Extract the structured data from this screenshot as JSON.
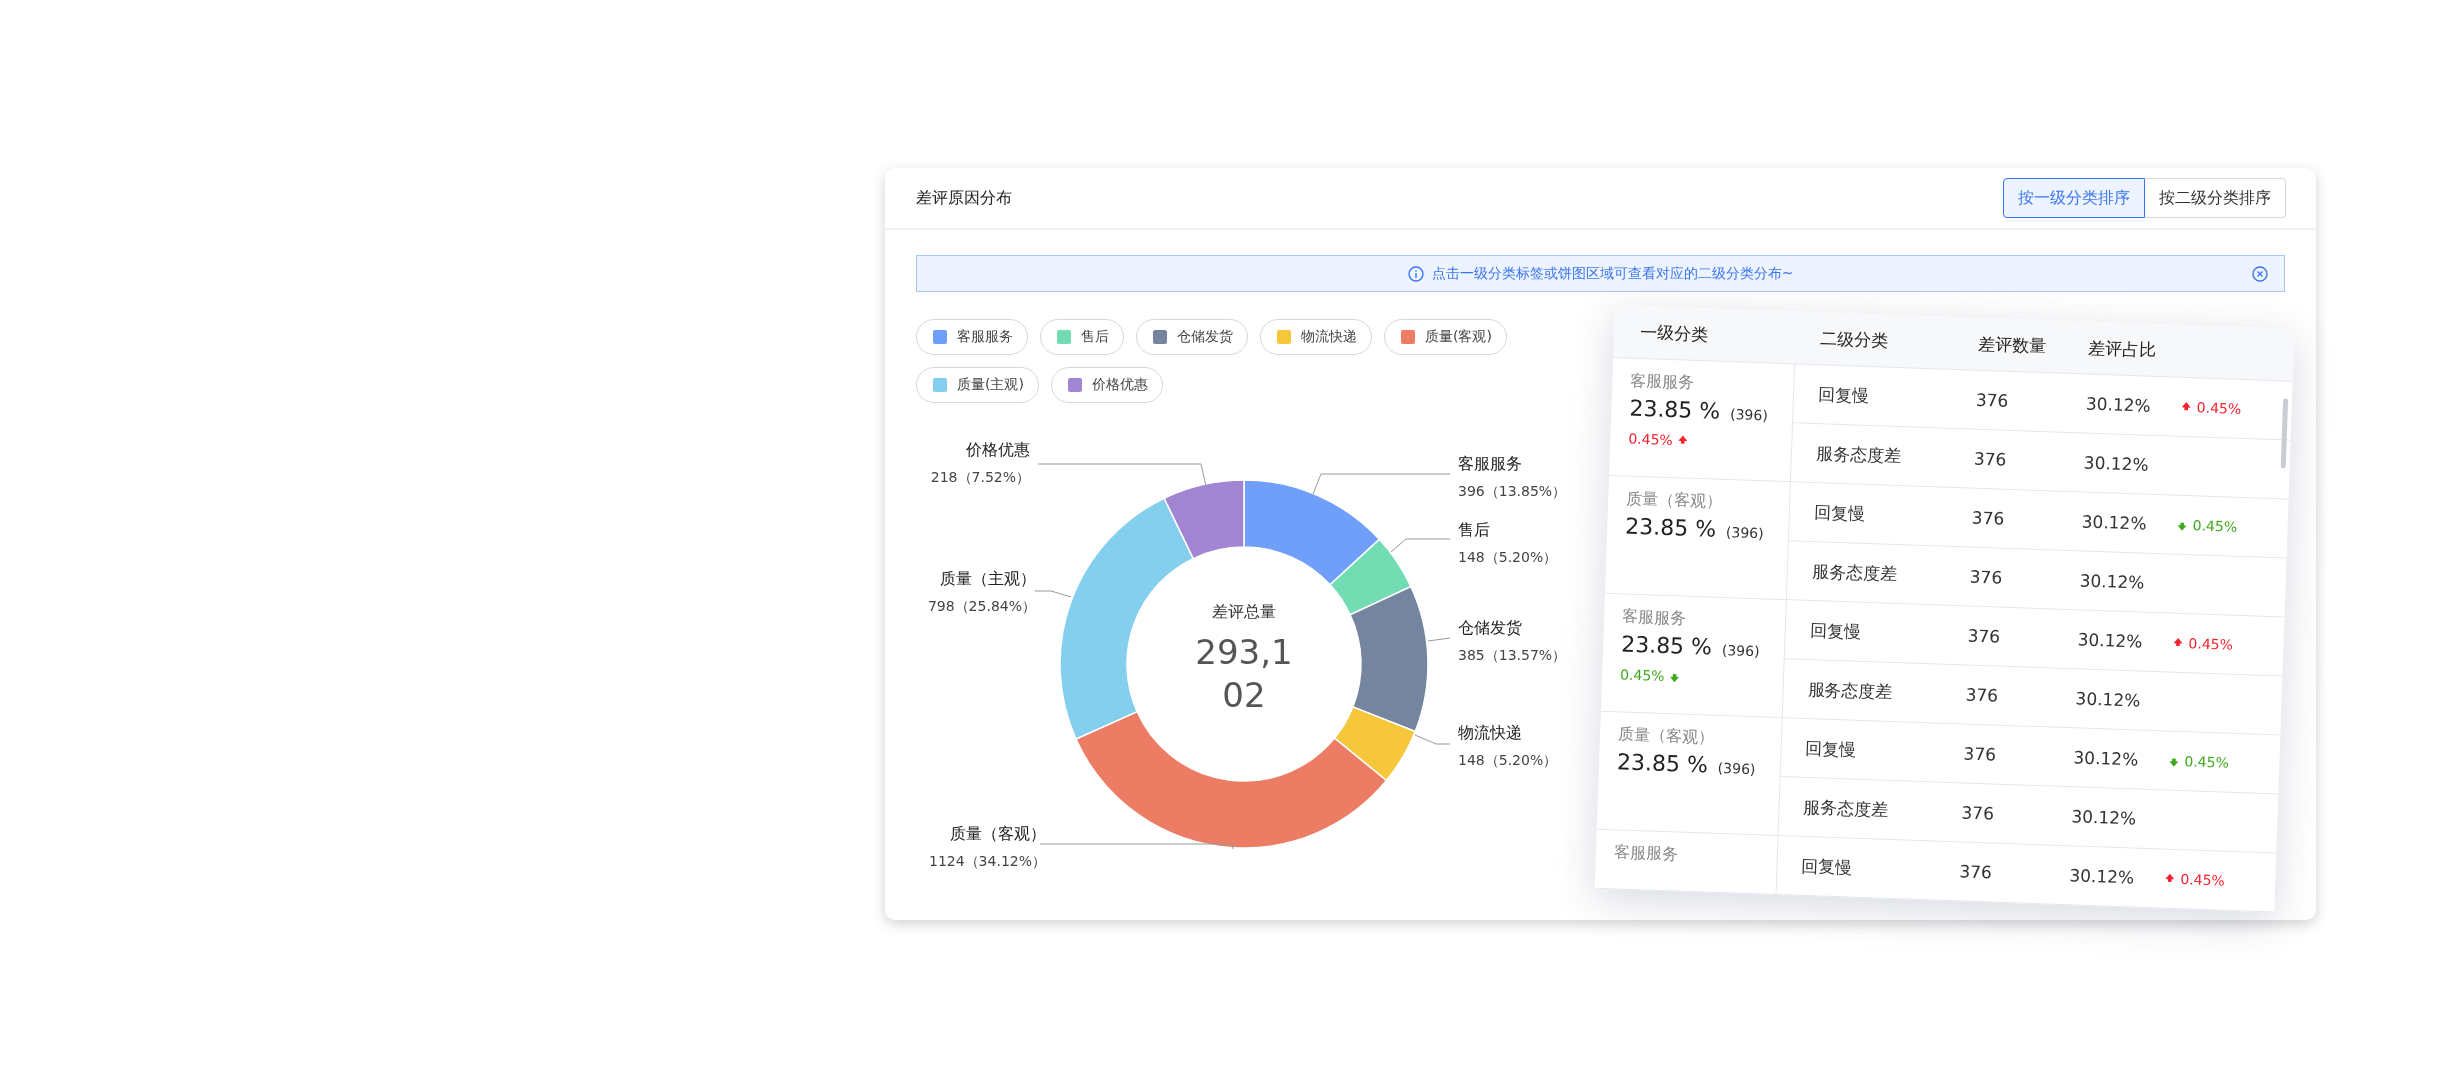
{
  "panel": {
    "title": "差评原因分布",
    "sort_buttons": [
      {
        "label": "按一级分类排序",
        "selected": true
      },
      {
        "label": "按二级分类排序",
        "selected": false
      }
    ],
    "notice": {
      "text": "点击一级分类标签或饼图区域可查看对应的二级分类分布~"
    },
    "legend": [
      {
        "label": "客服服务",
        "color": "#6f9ff9"
      },
      {
        "label": "售后",
        "color": "#72dcb3"
      },
      {
        "label": "仓储发货",
        "color": "#75849f"
      },
      {
        "label": "物流快递",
        "color": "#f6c63b"
      },
      {
        "label": "质量(客观)",
        "color": "#ec7c64"
      },
      {
        "label": "质量(主观)",
        "color": "#84cfee"
      },
      {
        "label": "价格优惠",
        "color": "#a185d3"
      }
    ],
    "chart": {
      "center_label": "差评总量",
      "center_value": "293,102",
      "chart_data": {
        "type": "donut",
        "categories": [
          "客服服务",
          "售后",
          "仓储发货",
          "物流快递",
          "质量（客观）",
          "质量（主观）",
          "价格优惠"
        ],
        "values": [
          13.85,
          5.2,
          13.57,
          5.2,
          34.12,
          25.84,
          7.52
        ],
        "value_labels": [
          "396（13.85%）",
          "148（5.20%）",
          "385（13.57%）",
          "148（5.20%）",
          "1124（34.12%）",
          "798（25.84%）",
          "218（7.52%）"
        ]
      }
    },
    "table": {
      "columns": [
        "一级分类",
        "二级分类",
        "差评数量",
        "差评占比"
      ],
      "groups": [
        {
          "category": "客服服务",
          "percent": "23.85 %",
          "count": "(396)",
          "change": {
            "kind": "up",
            "text": "0.45%"
          },
          "rows": [
            {
              "name": "回复慢",
              "count": "376",
              "ratio": "30.12%",
              "change": {
                "kind": "up",
                "text": "0.45%"
              }
            },
            {
              "name": "服务态度差",
              "count": "376",
              "ratio": "30.12%"
            }
          ]
        },
        {
          "category": "质量（客观）",
          "percent": "23.85 %",
          "count": "(396)",
          "rows": [
            {
              "name": "回复慢",
              "count": "376",
              "ratio": "30.12%",
              "change": {
                "kind": "down",
                "text": "0.45%"
              }
            },
            {
              "name": "服务态度差",
              "count": "376",
              "ratio": "30.12%"
            }
          ]
        },
        {
          "category": "客服服务",
          "percent": "23.85 %",
          "count": "(396)",
          "change": {
            "kind": "down",
            "text": "0.45%"
          },
          "rows": [
            {
              "name": "回复慢",
              "count": "376",
              "ratio": "30.12%",
              "change": {
                "kind": "up",
                "text": "0.45%"
              }
            },
            {
              "name": "服务态度差",
              "count": "376",
              "ratio": "30.12%"
            }
          ]
        },
        {
          "category": "质量（客观）",
          "percent": "23.85 %",
          "count": "(396)",
          "rows": [
            {
              "name": "回复慢",
              "count": "376",
              "ratio": "30.12%",
              "change": {
                "kind": "down",
                "text": "0.45%"
              }
            },
            {
              "name": "服务态度差",
              "count": "376",
              "ratio": "30.12%"
            }
          ]
        },
        {
          "category": "客服服务",
          "rows": [
            {
              "name": "回复慢",
              "count": "376",
              "ratio": "30.12%",
              "change": {
                "kind": "up",
                "text": "0.45%"
              }
            }
          ]
        }
      ]
    }
  }
}
